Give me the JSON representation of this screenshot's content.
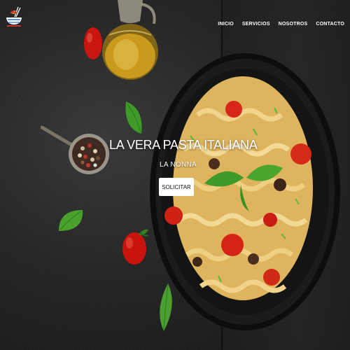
{
  "header": {
    "logo_icon": "spaghetti-bowl-icon",
    "nav": [
      {
        "label": "INICIO"
      },
      {
        "label": "SERVICIOS"
      },
      {
        "label": "NOSOTROS"
      },
      {
        "label": "CONTACTO"
      }
    ]
  },
  "hero": {
    "title": "LA VERA PASTA ITALIANA",
    "subtitle": "LA NONNA",
    "cta_label": "SOLICITAR"
  },
  "colors": {
    "background": "#262626",
    "pasta": "#e9c36a",
    "tomato": "#d41f14",
    "basil": "#3f9a2a",
    "button_bg": "#ffffff",
    "button_text": "#111111"
  }
}
